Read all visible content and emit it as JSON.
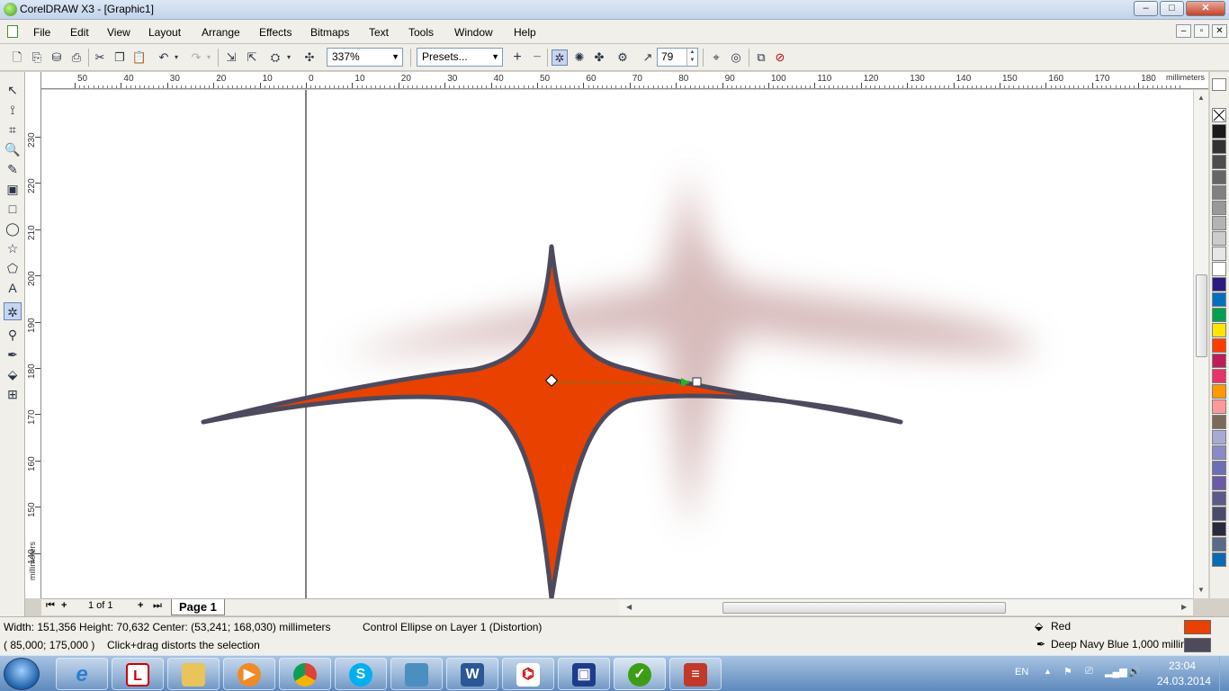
{
  "window": {
    "title": "CorelDRAW X3 - [Graphic1]",
    "min": "–",
    "max": "□",
    "close": "✕"
  },
  "menu": {
    "items": [
      "File",
      "Edit",
      "View",
      "Layout",
      "Arrange",
      "Effects",
      "Bitmaps",
      "Text",
      "Tools",
      "Window",
      "Help"
    ],
    "mdi": [
      "–",
      "▫",
      "✕"
    ]
  },
  "toolbar": {
    "zoom": "337%",
    "presets": "Presets...",
    "distortion_amplitude": "79"
  },
  "ruler": {
    "h_labels": [
      "50",
      "40",
      "30",
      "20",
      "10",
      "0",
      "10",
      "20",
      "30",
      "40",
      "50",
      "60",
      "70",
      "80",
      "90",
      "100",
      "110",
      "120",
      "130",
      "140",
      "150",
      "160",
      "170",
      "180"
    ],
    "v_labels": [
      "230",
      "220",
      "210",
      "200",
      "190",
      "180",
      "170",
      "160",
      "150",
      "140"
    ],
    "units": "millimeters"
  },
  "palette": {
    "colors": [
      "#1a1a1a",
      "#333333",
      "#4d4d4d",
      "#666666",
      "#808080",
      "#999999",
      "#b3b3b3",
      "#cccccc",
      "#e6e6e6",
      "#ffffff",
      "#2b1a80",
      "#0070c0",
      "#00a050",
      "#ffe600",
      "#ff3c00",
      "#c01e58",
      "#e8326a",
      "#ff9900",
      "#ff9999",
      "#7b6a5a",
      "#a9a9d6",
      "#8a8ac8",
      "#6e6eb4",
      "#6a5aa8",
      "#5a5a8c",
      "#4a4a6a",
      "#2a2a3a",
      "#5a6a8a",
      "#0a6ab4"
    ]
  },
  "pages": {
    "counter": "1 of 1",
    "tab": "Page 1"
  },
  "status": {
    "dimensions": "Width: 151,356  Height: 70,632  Center: (53,241; 168,030)  millimeters",
    "object": "Control Ellipse on Layer 1  (Distortion)",
    "coords": "( 85,000; 175,000 )",
    "hint": "Click+drag distorts the selection",
    "fill_name": "Red",
    "fill_color": "#e84100",
    "outline_name": "Deep Navy Blue  1,000 millimet",
    "outline_color": "#4e4a5e"
  },
  "shape": {
    "fill": "#e84100",
    "outline": "#4e4a5e",
    "ghost": "#caa5a5"
  },
  "taskbar": {
    "apps": [
      "ie",
      "l-app",
      "explorer",
      "media",
      "chrome",
      "skype",
      "photos",
      "word",
      "pdf",
      "save",
      "corel",
      "books"
    ],
    "language": "EN",
    "time": "23:04",
    "date": "24.03.2014"
  }
}
